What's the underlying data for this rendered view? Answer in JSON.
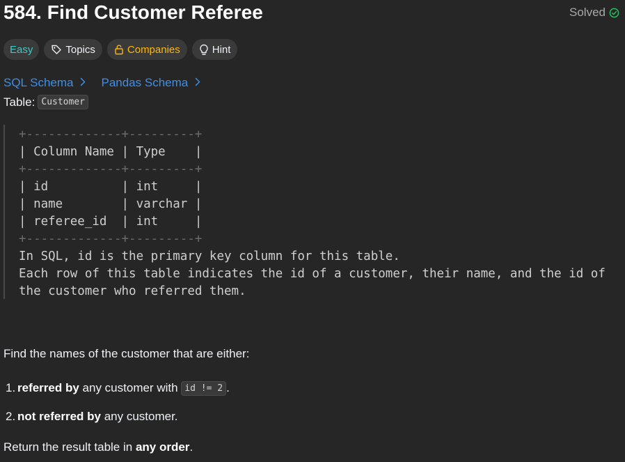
{
  "problem": {
    "title": "584. Find Customer Referee",
    "status": "Solved",
    "status_color": "#2cbb5d"
  },
  "tags": {
    "difficulty": "Easy",
    "topics": "Topics",
    "companies": "Companies",
    "hint": "Hint"
  },
  "schemas": {
    "sql": "SQL Schema",
    "pandas": "Pandas Schema"
  },
  "table_label": {
    "prefix": "Table:",
    "name": "Customer"
  },
  "schema_block": {
    "border_top": "+-------------+---------+",
    "header": "| Column Name | Type    |",
    "border_mid": "+-------------+---------+",
    "rows": [
      "| id          | int     |",
      "| name        | varchar |",
      "| referee_id  | int     |"
    ],
    "border_bottom": "+-------------+---------+",
    "notes": [
      "In SQL, id is the primary key column for this table.",
      "Each row of this table indicates the id of a customer, their name, and the id of",
      "the customer who referred them."
    ]
  },
  "description": {
    "intro": "Find the names of the customer that are either:",
    "items": [
      {
        "num": "1.",
        "bold": "referred by",
        "text": " any customer with ",
        "code": "id != 2",
        "tail": "."
      },
      {
        "num": "2.",
        "bold": "not referred by",
        "text": " any customer.",
        "code": "",
        "tail": ""
      }
    ],
    "return_prefix": "Return the result table in ",
    "return_bold": "any order",
    "return_suffix": "."
  }
}
